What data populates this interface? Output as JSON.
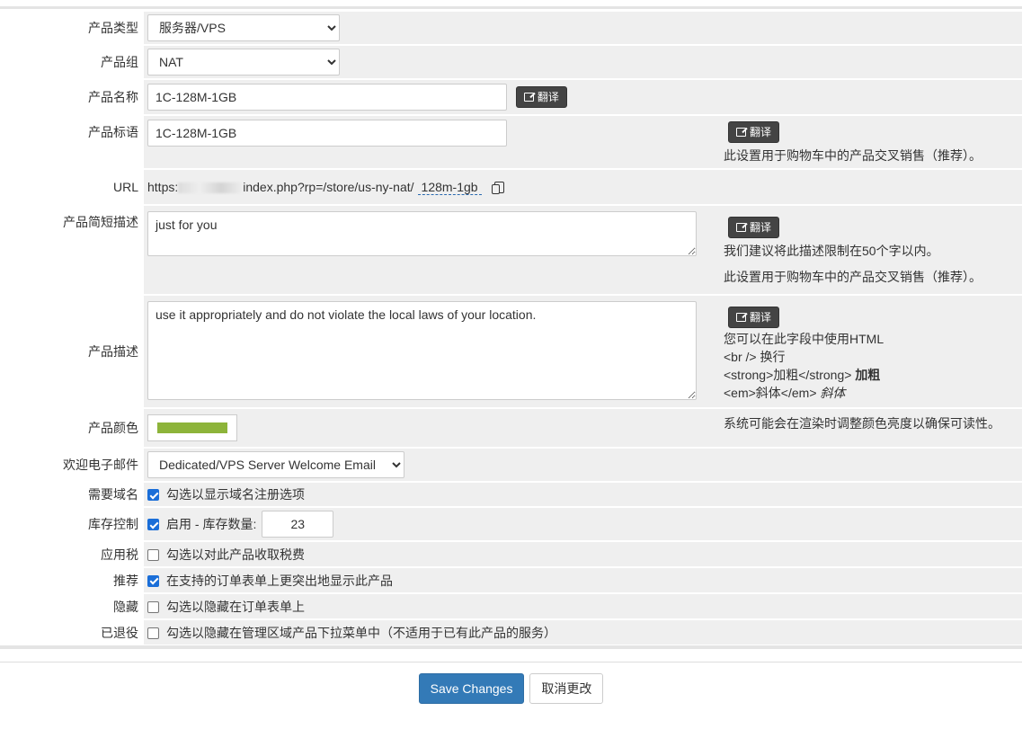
{
  "colors": {
    "accent": "#337ab7",
    "product_color": "#8db43a"
  },
  "fields": {
    "product_type": {
      "label": "产品类型",
      "value": "服务器/VPS"
    },
    "product_group": {
      "label": "产品组",
      "value": "NAT"
    },
    "product_name": {
      "label": "产品名称",
      "value": "1C-128M-1GB",
      "translate": "翻译"
    },
    "product_tagline": {
      "label": "产品标语",
      "value": "1C-128M-1GB",
      "translate": "翻译",
      "help": "此设置用于购物车中的产品交叉销售（推荐）。"
    },
    "url": {
      "label": "URL",
      "prefix": "https:",
      "path": "index.php?rp=/store/us-ny-nat/",
      "slug": "128m-1gb"
    },
    "short_desc": {
      "label": "产品简短描述",
      "value": "just for you",
      "translate": "翻译",
      "help1": "我们建议将此描述限制在50个字以内。",
      "help2": "此设置用于购物车中的产品交叉销售（推荐）。"
    },
    "description": {
      "label": "产品描述",
      "value": "use it appropriately and do not violate the local laws of your location.",
      "translate": "翻译",
      "help_html": "您可以在此字段中使用HTML",
      "help_br": "<br /> 换行",
      "help_strong": "<strong>加粗</strong>",
      "help_strong_demo": "加粗",
      "help_em": "<em>斜体</em>",
      "help_em_demo": "斜体"
    },
    "product_color": {
      "label": "产品颜色",
      "help": "系统可能会在渲染时调整颜色亮度以确保可读性。"
    },
    "welcome_email": {
      "label": "欢迎电子邮件",
      "value": "Dedicated/VPS Server Welcome Email"
    },
    "require_domain": {
      "label": "需要域名",
      "text": "勾选以显示域名注册选项",
      "checked": true
    },
    "stock_control": {
      "label": "库存控制",
      "text": "启用 - 库存数量:",
      "quantity": "23",
      "checked": true
    },
    "apply_tax": {
      "label": "应用税",
      "text": "勾选以对此产品收取税费",
      "checked": false
    },
    "featured": {
      "label": "推荐",
      "text": "在支持的订单表单上更突出地显示此产品",
      "checked": true
    },
    "hidden": {
      "label": "隐藏",
      "text": "勾选以隐藏在订单表单上",
      "checked": false
    },
    "retired": {
      "label": "已退役",
      "text": "勾选以隐藏在管理区域产品下拉菜单中（不适用于已有此产品的服务）",
      "checked": false
    }
  },
  "footer": {
    "save_label": "Save Changes",
    "cancel_label": "取消更改"
  }
}
